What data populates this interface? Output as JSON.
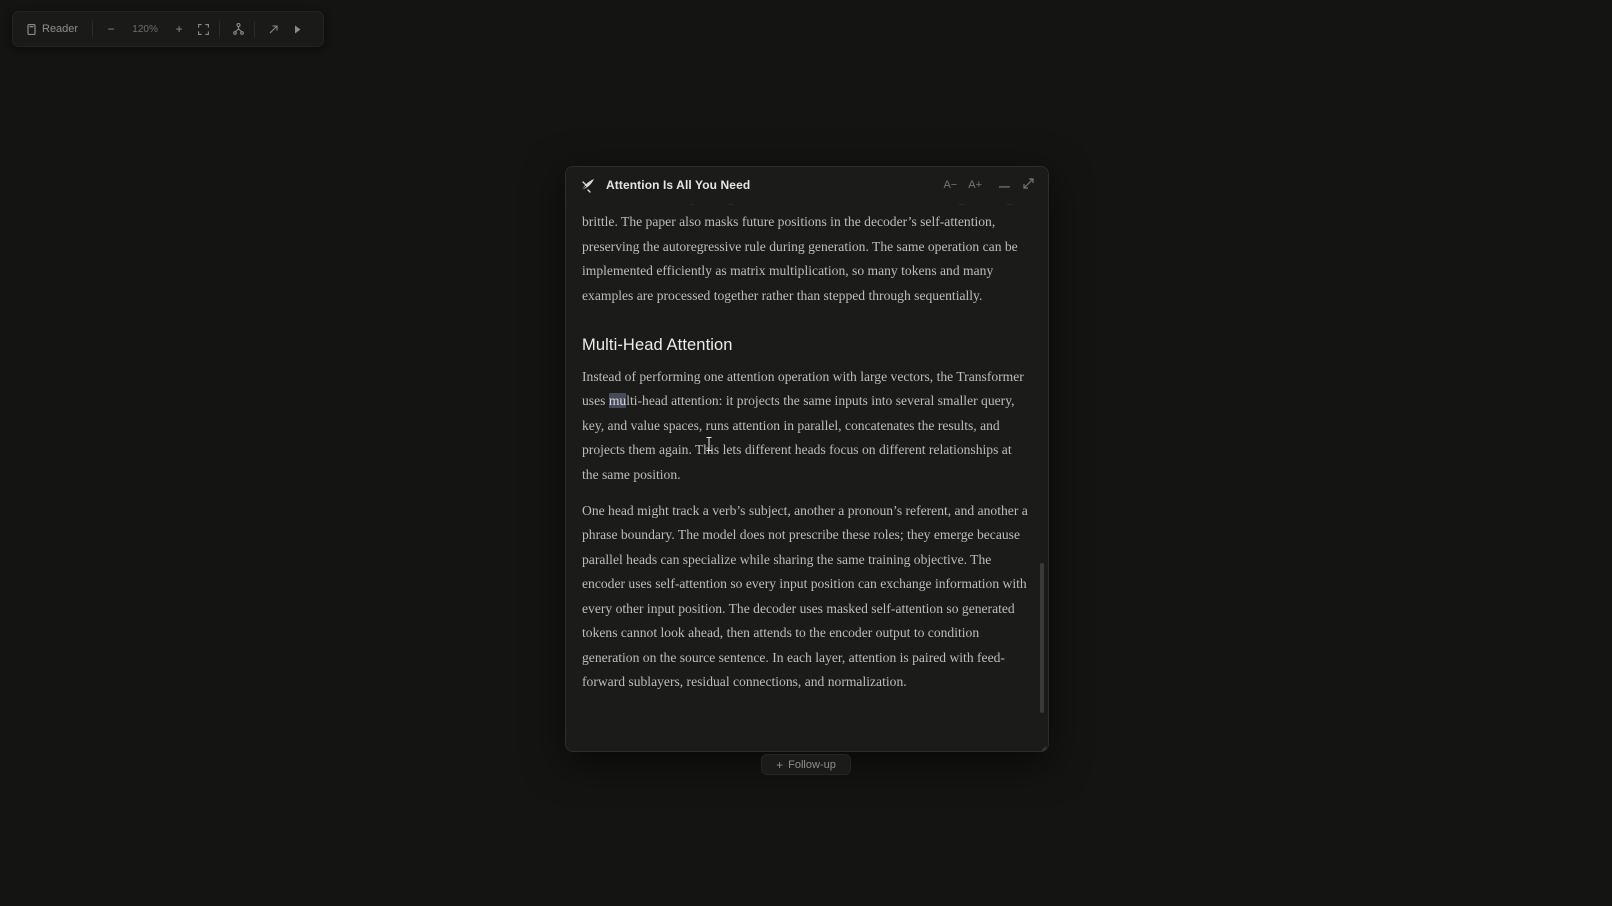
{
  "toolbar": {
    "reader_label": "Reader",
    "zoom_out_label": "−",
    "zoom_level": "120%",
    "zoom_in_label": "+",
    "icons": [
      "book-icon",
      "fullscreen-icon",
      "tree-icon",
      "open-external-icon",
      "play-icon"
    ]
  },
  "panel": {
    "title": "Attention Is All You Need",
    "font_decrease_label": "A−",
    "font_increase_label": "A+",
    "icons": [
      "quill-icon",
      "minimize-icon",
      "expand-icon",
      "resize-grip-icon"
    ],
    "paragraph_1": "the distribution sharp enough to choose useful context without making learning brittle. The paper also masks future positions in the decoder’s self-attention, preserving the autoregressive rule during generation. The same operation can be implemented efficiently as matrix multiplication, so many tokens and many examples are processed together rather than stepped through sequentially.",
    "heading": "Multi-Head Attention",
    "paragraph_2_before": "Instead of performing one attention operation with large vectors, the Transformer uses ",
    "paragraph_2_selected": "mu",
    "paragraph_2_after": "lti-head attention: it projects the same inputs into several smaller query, key, and value spaces, runs attention in parallel, concatenates the results, and projects them again. This lets different heads focus on different relationships at the same position.",
    "paragraph_3": "One head might track a verb’s subject, another a pronoun’s referent, and another a phrase boundary. The model does not prescribe these roles; they emerge because parallel heads can specialize while sharing the same training objective. The encoder uses self-attention so every input position can exchange information with every other input position. The decoder uses masked self-attention so generated tokens cannot look ahead, then attends to the encoder output to condition generation on the source sentence. In each layer, attention is paired with feed-forward sublayers, residual connections, and normalization."
  },
  "followup": {
    "plus": "+",
    "label": "Follow-up"
  },
  "colors": {
    "background": "#141413",
    "panel": "#1b1b1a",
    "selection": "#474a58",
    "text": "#bdbdb9",
    "heading": "#ededea"
  }
}
